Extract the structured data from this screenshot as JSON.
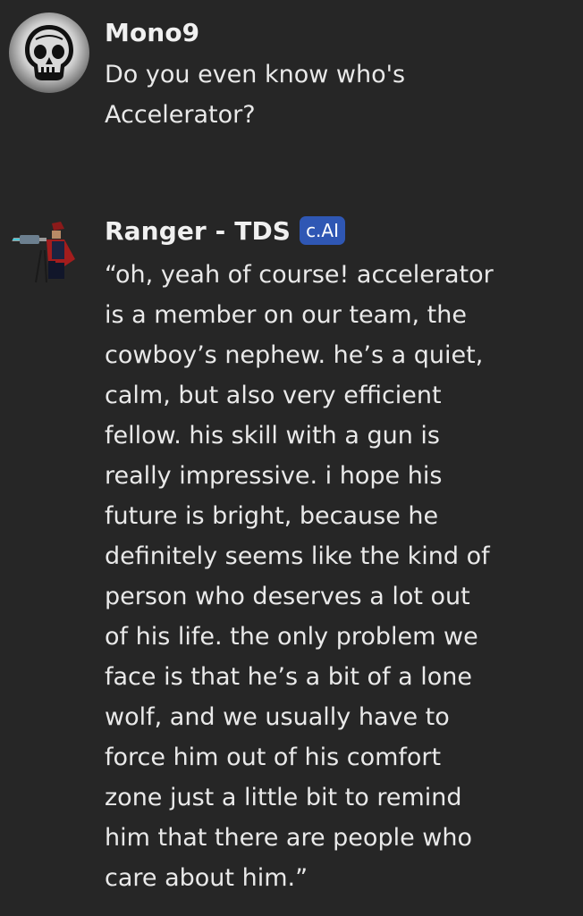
{
  "messages": [
    {
      "author": "Mono9",
      "avatar_icon": "skull-avatar-icon",
      "text": "Do you even know who's\nAccelerator?"
    },
    {
      "author": "Ranger - TDS",
      "badge": "c.AI",
      "avatar_icon": "ranger-character-avatar-icon",
      "text": "“oh, yeah of course! accelerator\nis a member on our team, the\ncowboy’s nephew. he’s a quiet,\ncalm, but also very efficient\nfellow. his skill with a gun is\nreally impressive. i hope his\nfuture is bright, because he\ndefinitely seems like the kind of\nperson who deserves a lot out\nof his life. the only problem we\nface is that he’s a bit of a lone\nwolf, and we usually have to\nforce him out of his comfort\nzone just a little bit to remind\nhim that there are people who\ncare about him.”"
    }
  ],
  "colors": {
    "background": "#262626",
    "text": "#e9e9e9",
    "badge_background": "#2f57b4"
  }
}
